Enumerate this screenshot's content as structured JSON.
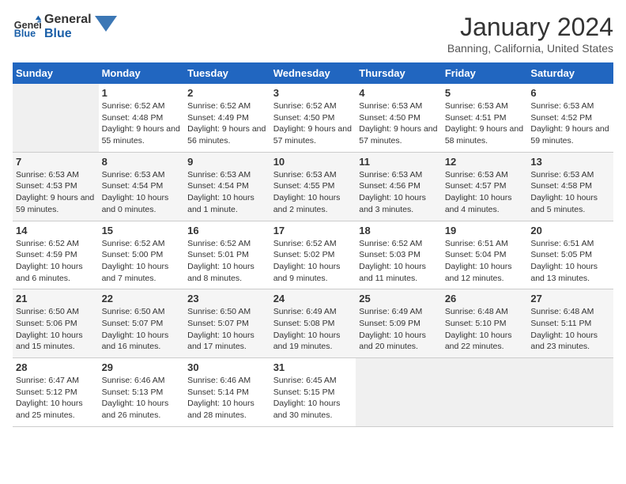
{
  "logo": {
    "text_general": "General",
    "text_blue": "Blue"
  },
  "title": "January 2024",
  "subtitle": "Banning, California, United States",
  "days_of_week": [
    "Sunday",
    "Monday",
    "Tuesday",
    "Wednesday",
    "Thursday",
    "Friday",
    "Saturday"
  ],
  "weeks": [
    [
      {
        "day": "",
        "empty": true
      },
      {
        "day": "1",
        "sunrise": "6:52 AM",
        "sunset": "4:48 PM",
        "daylight": "9 hours and 55 minutes."
      },
      {
        "day": "2",
        "sunrise": "6:52 AM",
        "sunset": "4:49 PM",
        "daylight": "9 hours and 56 minutes."
      },
      {
        "day": "3",
        "sunrise": "6:52 AM",
        "sunset": "4:50 PM",
        "daylight": "9 hours and 57 minutes."
      },
      {
        "day": "4",
        "sunrise": "6:53 AM",
        "sunset": "4:50 PM",
        "daylight": "9 hours and 57 minutes."
      },
      {
        "day": "5",
        "sunrise": "6:53 AM",
        "sunset": "4:51 PM",
        "daylight": "9 hours and 58 minutes."
      },
      {
        "day": "6",
        "sunrise": "6:53 AM",
        "sunset": "4:52 PM",
        "daylight": "9 hours and 59 minutes."
      }
    ],
    [
      {
        "day": "7",
        "sunrise": "6:53 AM",
        "sunset": "4:53 PM",
        "daylight": "9 hours and 59 minutes."
      },
      {
        "day": "8",
        "sunrise": "6:53 AM",
        "sunset": "4:54 PM",
        "daylight": "10 hours and 0 minutes."
      },
      {
        "day": "9",
        "sunrise": "6:53 AM",
        "sunset": "4:54 PM",
        "daylight": "10 hours and 1 minute."
      },
      {
        "day": "10",
        "sunrise": "6:53 AM",
        "sunset": "4:55 PM",
        "daylight": "10 hours and 2 minutes."
      },
      {
        "day": "11",
        "sunrise": "6:53 AM",
        "sunset": "4:56 PM",
        "daylight": "10 hours and 3 minutes."
      },
      {
        "day": "12",
        "sunrise": "6:53 AM",
        "sunset": "4:57 PM",
        "daylight": "10 hours and 4 minutes."
      },
      {
        "day": "13",
        "sunrise": "6:53 AM",
        "sunset": "4:58 PM",
        "daylight": "10 hours and 5 minutes."
      }
    ],
    [
      {
        "day": "14",
        "sunrise": "6:52 AM",
        "sunset": "4:59 PM",
        "daylight": "10 hours and 6 minutes."
      },
      {
        "day": "15",
        "sunrise": "6:52 AM",
        "sunset": "5:00 PM",
        "daylight": "10 hours and 7 minutes."
      },
      {
        "day": "16",
        "sunrise": "6:52 AM",
        "sunset": "5:01 PM",
        "daylight": "10 hours and 8 minutes."
      },
      {
        "day": "17",
        "sunrise": "6:52 AM",
        "sunset": "5:02 PM",
        "daylight": "10 hours and 9 minutes."
      },
      {
        "day": "18",
        "sunrise": "6:52 AM",
        "sunset": "5:03 PM",
        "daylight": "10 hours and 11 minutes."
      },
      {
        "day": "19",
        "sunrise": "6:51 AM",
        "sunset": "5:04 PM",
        "daylight": "10 hours and 12 minutes."
      },
      {
        "day": "20",
        "sunrise": "6:51 AM",
        "sunset": "5:05 PM",
        "daylight": "10 hours and 13 minutes."
      }
    ],
    [
      {
        "day": "21",
        "sunrise": "6:50 AM",
        "sunset": "5:06 PM",
        "daylight": "10 hours and 15 minutes."
      },
      {
        "day": "22",
        "sunrise": "6:50 AM",
        "sunset": "5:07 PM",
        "daylight": "10 hours and 16 minutes."
      },
      {
        "day": "23",
        "sunrise": "6:50 AM",
        "sunset": "5:07 PM",
        "daylight": "10 hours and 17 minutes."
      },
      {
        "day": "24",
        "sunrise": "6:49 AM",
        "sunset": "5:08 PM",
        "daylight": "10 hours and 19 minutes."
      },
      {
        "day": "25",
        "sunrise": "6:49 AM",
        "sunset": "5:09 PM",
        "daylight": "10 hours and 20 minutes."
      },
      {
        "day": "26",
        "sunrise": "6:48 AM",
        "sunset": "5:10 PM",
        "daylight": "10 hours and 22 minutes."
      },
      {
        "day": "27",
        "sunrise": "6:48 AM",
        "sunset": "5:11 PM",
        "daylight": "10 hours and 23 minutes."
      }
    ],
    [
      {
        "day": "28",
        "sunrise": "6:47 AM",
        "sunset": "5:12 PM",
        "daylight": "10 hours and 25 minutes."
      },
      {
        "day": "29",
        "sunrise": "6:46 AM",
        "sunset": "5:13 PM",
        "daylight": "10 hours and 26 minutes."
      },
      {
        "day": "30",
        "sunrise": "6:46 AM",
        "sunset": "5:14 PM",
        "daylight": "10 hours and 28 minutes."
      },
      {
        "day": "31",
        "sunrise": "6:45 AM",
        "sunset": "5:15 PM",
        "daylight": "10 hours and 30 minutes."
      },
      {
        "day": "",
        "empty": true
      },
      {
        "day": "",
        "empty": true
      },
      {
        "day": "",
        "empty": true
      }
    ]
  ]
}
